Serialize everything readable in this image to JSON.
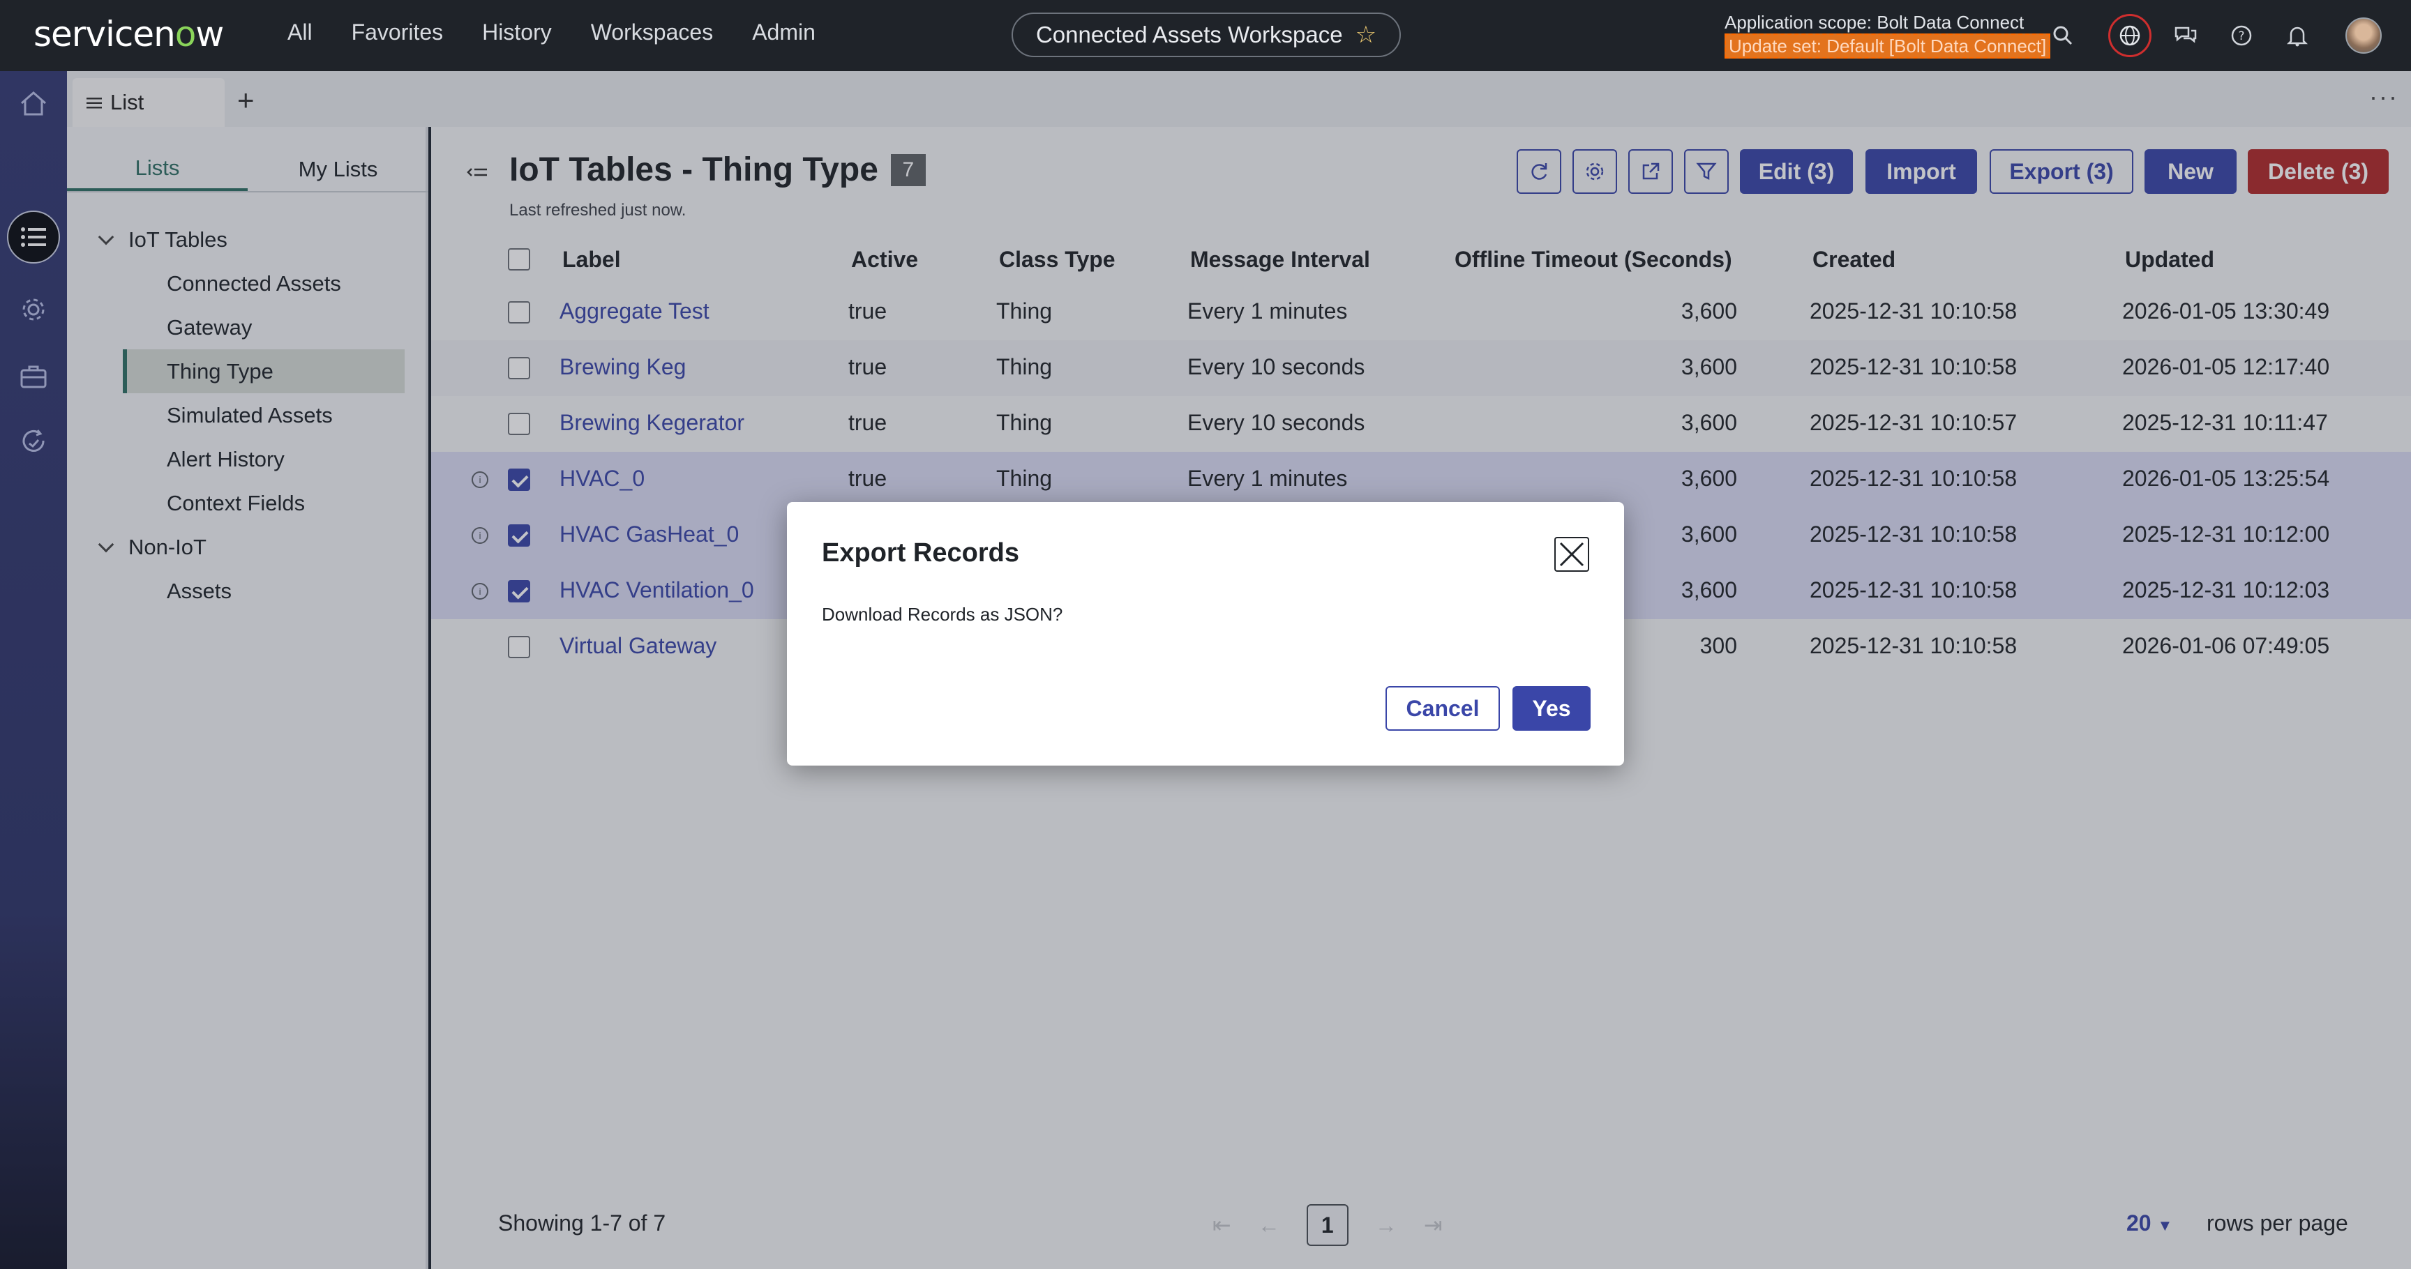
{
  "topnav": {
    "logo_prefix": "servicen",
    "logo_o": "o",
    "logo_suffix": "w",
    "items": [
      "All",
      "Favorites",
      "History",
      "Workspaces",
      "Admin"
    ],
    "workspace_pill": "Connected Assets Workspace",
    "scope_line": "Application scope: Bolt Data Connect",
    "update_set": "Update set: Default [Bolt Data Connect]"
  },
  "tabstrip": {
    "tab_label": "List"
  },
  "sidebar": {
    "tabs": [
      "Lists",
      "My Lists"
    ],
    "groups": [
      {
        "label": "IoT Tables",
        "items": [
          "Connected Assets",
          "Gateway",
          "Thing Type",
          "Simulated Assets",
          "Alert History",
          "Context Fields"
        ]
      },
      {
        "label": "Non-IoT",
        "items": [
          "Assets"
        ]
      }
    ],
    "selected": "Thing Type"
  },
  "list": {
    "title": "IoT Tables - Thing Type",
    "count": "7",
    "refreshed": "Last refreshed just now.",
    "buttons": {
      "edit": "Edit (3)",
      "import": "Import",
      "export": "Export (3)",
      "new": "New",
      "delete": "Delete (3)"
    },
    "columns": [
      "Label",
      "Active",
      "Class Type",
      "Message Interval",
      "Offline Timeout (Seconds)",
      "Created",
      "Updated"
    ],
    "rows": [
      {
        "label": "Aggregate Test",
        "active": "true",
        "class": "Thing",
        "interval": "Every 1 minutes",
        "timeout": "3,600",
        "created": "2025-12-31 10:10:58",
        "updated": "2026-01-05 13:30:49",
        "checked": false
      },
      {
        "label": "Brewing Keg",
        "active": "true",
        "class": "Thing",
        "interval": "Every 10 seconds",
        "timeout": "3,600",
        "created": "2025-12-31 10:10:58",
        "updated": "2026-01-05 12:17:40",
        "checked": false
      },
      {
        "label": "Brewing Kegerator",
        "active": "true",
        "class": "Thing",
        "interval": "Every 10 seconds",
        "timeout": "3,600",
        "created": "2025-12-31 10:10:57",
        "updated": "2025-12-31 10:11:47",
        "checked": false
      },
      {
        "label": "HVAC_0",
        "active": "true",
        "class": "Thing",
        "interval": "Every 1 minutes",
        "timeout": "3,600",
        "created": "2025-12-31 10:10:58",
        "updated": "2026-01-05 13:25:54",
        "checked": true
      },
      {
        "label": "HVAC GasHeat_0",
        "active": "",
        "class": "",
        "interval": "",
        "timeout": "3,600",
        "created": "2025-12-31 10:10:58",
        "updated": "2025-12-31 10:12:00",
        "checked": true
      },
      {
        "label": "HVAC Ventilation_0",
        "active": "",
        "class": "",
        "interval": "",
        "timeout": "3,600",
        "created": "2025-12-31 10:10:58",
        "updated": "2025-12-31 10:12:03",
        "checked": true
      },
      {
        "label": "Virtual Gateway",
        "active": "",
        "class": "",
        "interval": "",
        "timeout": "300",
        "created": "2025-12-31 10:10:58",
        "updated": "2026-01-06 07:49:05",
        "checked": false
      }
    ],
    "footer": {
      "showing": "Showing 1-7 of 7",
      "page": "1",
      "rows_per_page_value": "20",
      "rows_per_page_label": "rows per page"
    }
  },
  "modal": {
    "title": "Export Records",
    "body": "Download Records as JSON?",
    "cancel": "Cancel",
    "yes": "Yes"
  },
  "colors": {
    "primary": "#3a46a8",
    "danger": "#b02a2a",
    "accent_green": "#2f6f64",
    "update_set_bg": "#e3731d"
  }
}
